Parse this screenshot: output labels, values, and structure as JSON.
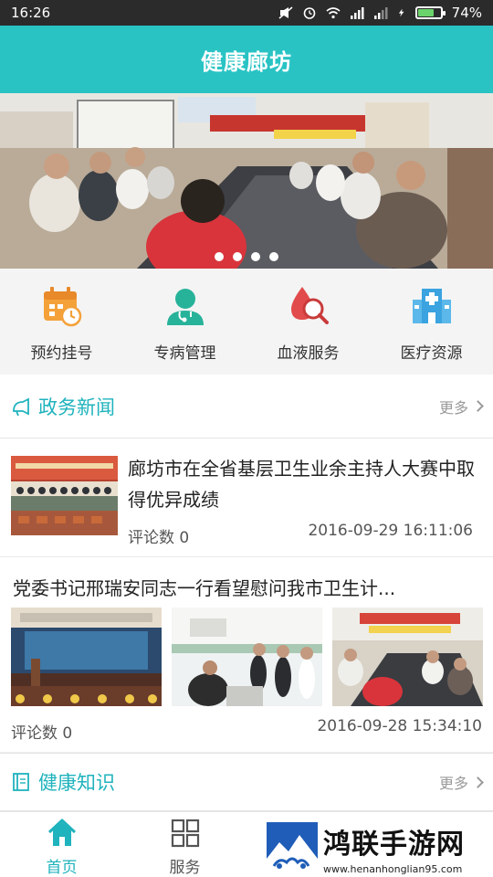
{
  "status_bar": {
    "time": "16:26",
    "battery": "74%",
    "battery_level": 0.74
  },
  "header": {
    "title": "健康廊坊"
  },
  "banner": {
    "slide_count": 4,
    "active_slide": 0
  },
  "services": [
    {
      "label": "预约挂号",
      "icon": "calendar-clock-icon",
      "color": "#f4a13a"
    },
    {
      "label": "专病管理",
      "icon": "doctor-icon",
      "color": "#27b39a"
    },
    {
      "label": "血液服务",
      "icon": "blood-search-icon",
      "color": "#e24b4b"
    },
    {
      "label": "医疗资源",
      "icon": "hospital-icon",
      "color": "#3aa3e0"
    }
  ],
  "gov_news": {
    "title": "政务新闻",
    "more": "更多",
    "items": [
      {
        "title": "廊坊市在全省基层卫生业余主持人大赛中取得优异成绩",
        "comments": "评论数 0",
        "date": "2016-09-29 16:11:06"
      },
      {
        "title": "党委书记邢瑞安同志一行看望慰问我市卫生计...",
        "comments": "评论数 0",
        "date": "2016-09-28 15:34:10"
      }
    ]
  },
  "health_knowledge": {
    "title": "健康知识",
    "more": "更多"
  },
  "bottom_nav": {
    "home": "首页",
    "services": "服务"
  },
  "watermark": {
    "name": "鸿联手游网",
    "url": "www.henanhonglian95.com"
  },
  "colors": {
    "accent": "#29c3c4",
    "section_title": "#1fb3bd"
  }
}
